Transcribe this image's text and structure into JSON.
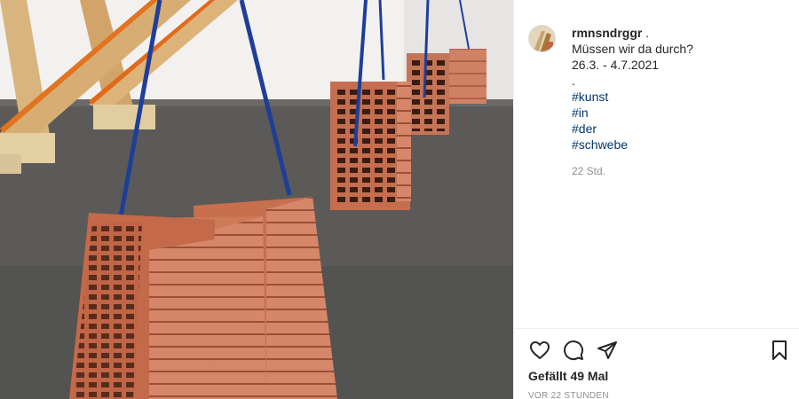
{
  "post": {
    "image_description_icon": "brick-sculpture-photo",
    "author": {
      "username": "rmnsndrggr",
      "username_suffix": " ."
    },
    "caption": {
      "line1": "Müssen wir da durch?",
      "line2": "26.3. - 4.7.2021",
      "line3": ".",
      "hashtags": [
        "#kunst",
        "#in",
        "#der",
        "#schwebe"
      ]
    },
    "comment_time": "22 Std.",
    "likes": "Gefällt 49 Mal",
    "posted_ago": "VOR 22 STUNDEN",
    "actions": {
      "like_icon": "heart-icon",
      "comment_icon": "comment-icon",
      "share_icon": "paper-plane-icon",
      "save_icon": "bookmark-icon"
    },
    "colors": {
      "hashtag": "#00376b",
      "muted": "#8e8e8e",
      "text": "#262626",
      "brick": "#c86f4e",
      "rope": "#1d3f9a"
    }
  }
}
